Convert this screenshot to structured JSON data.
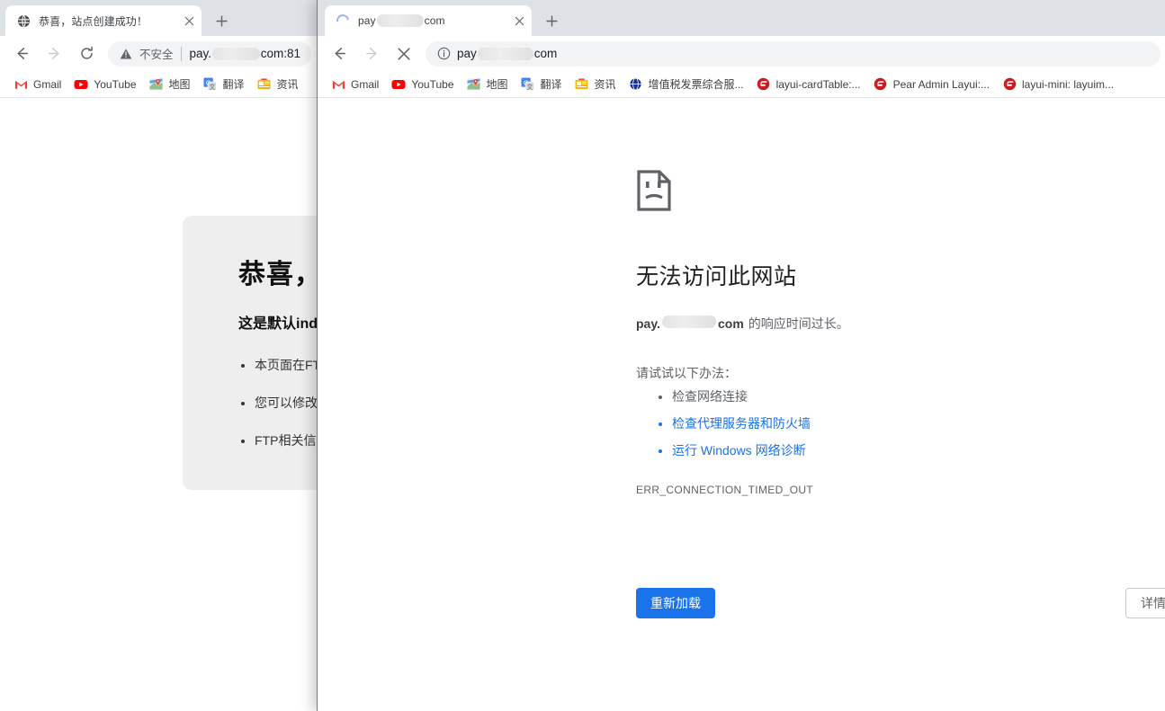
{
  "background_window": {
    "tab": {
      "title": "恭喜，站点创建成功！",
      "favicon": "globe-icon",
      "close_icon": "close-icon"
    },
    "newtab_label": "+",
    "toolbar": {
      "back_icon": "back-arrow-icon",
      "forward_icon": "forward-arrow-icon",
      "reload_icon": "reload-icon",
      "security_icon": "warning-triangle-icon",
      "security_label": "不安全",
      "url_prefix": "pay.",
      "url_suffix": "com:81"
    },
    "bookmarks": [
      {
        "label": "Gmail",
        "icon": "gmail-icon"
      },
      {
        "label": "YouTube",
        "icon": "youtube-icon"
      },
      {
        "label": "地图",
        "icon": "maps-icon"
      },
      {
        "label": "翻译",
        "icon": "translate-icon"
      },
      {
        "label": "资讯",
        "icon": "news-icon"
      }
    ],
    "page": {
      "heading": "恭喜，站点创建成功！",
      "subheading": "这是默认index.html，本页面由系统自动生成",
      "items": [
        "本页面在FTP根目录下的index.html",
        "您可以修改、删除或覆盖本页面",
        "FTP相关信息，请到面板查看"
      ]
    }
  },
  "foreground_window": {
    "tab": {
      "title_prefix": "pay",
      "title_suffix": "com",
      "favicon": "loading-spinner-icon",
      "close_icon": "close-icon"
    },
    "newtab_label": "+",
    "toolbar": {
      "back_icon": "back-arrow-icon",
      "forward_icon": "forward-arrow-icon",
      "stop_icon": "stop-x-icon",
      "security_icon": "info-circle-icon",
      "url_prefix": "pay",
      "url_suffix": "com"
    },
    "bookmarks": [
      {
        "label": "Gmail",
        "icon": "gmail-icon"
      },
      {
        "label": "YouTube",
        "icon": "youtube-icon"
      },
      {
        "label": "地图",
        "icon": "maps-icon"
      },
      {
        "label": "翻译",
        "icon": "translate-icon"
      },
      {
        "label": "资讯",
        "icon": "news-icon"
      },
      {
        "label": "增值税发票综合服...",
        "icon": "globe-blue-icon"
      },
      {
        "label": "layui-cardTable:...",
        "icon": "gitee-icon"
      },
      {
        "label": "Pear Admin Layui:...",
        "icon": "gitee-icon"
      },
      {
        "label": "layui-mini: layuim...",
        "icon": "gitee-icon"
      }
    ],
    "error_page": {
      "icon": "sad-page-icon",
      "heading": "无法访问此网站",
      "host_prefix": "pay.",
      "host_suffix": "com",
      "subtitle_rest": "的响应时间过长。",
      "try_label": "请试试以下办法：",
      "suggestions": [
        {
          "text": "检查网络连接",
          "link": false
        },
        {
          "text": "检查代理服务器和防火墙",
          "link": true
        },
        {
          "text": "运行 Windows 网络诊断",
          "link": true
        }
      ],
      "error_code": "ERR_CONNECTION_TIMED_OUT",
      "reload_button": "重新加载",
      "details_button": "详情",
      "accent_color": "#1a73e8"
    }
  }
}
